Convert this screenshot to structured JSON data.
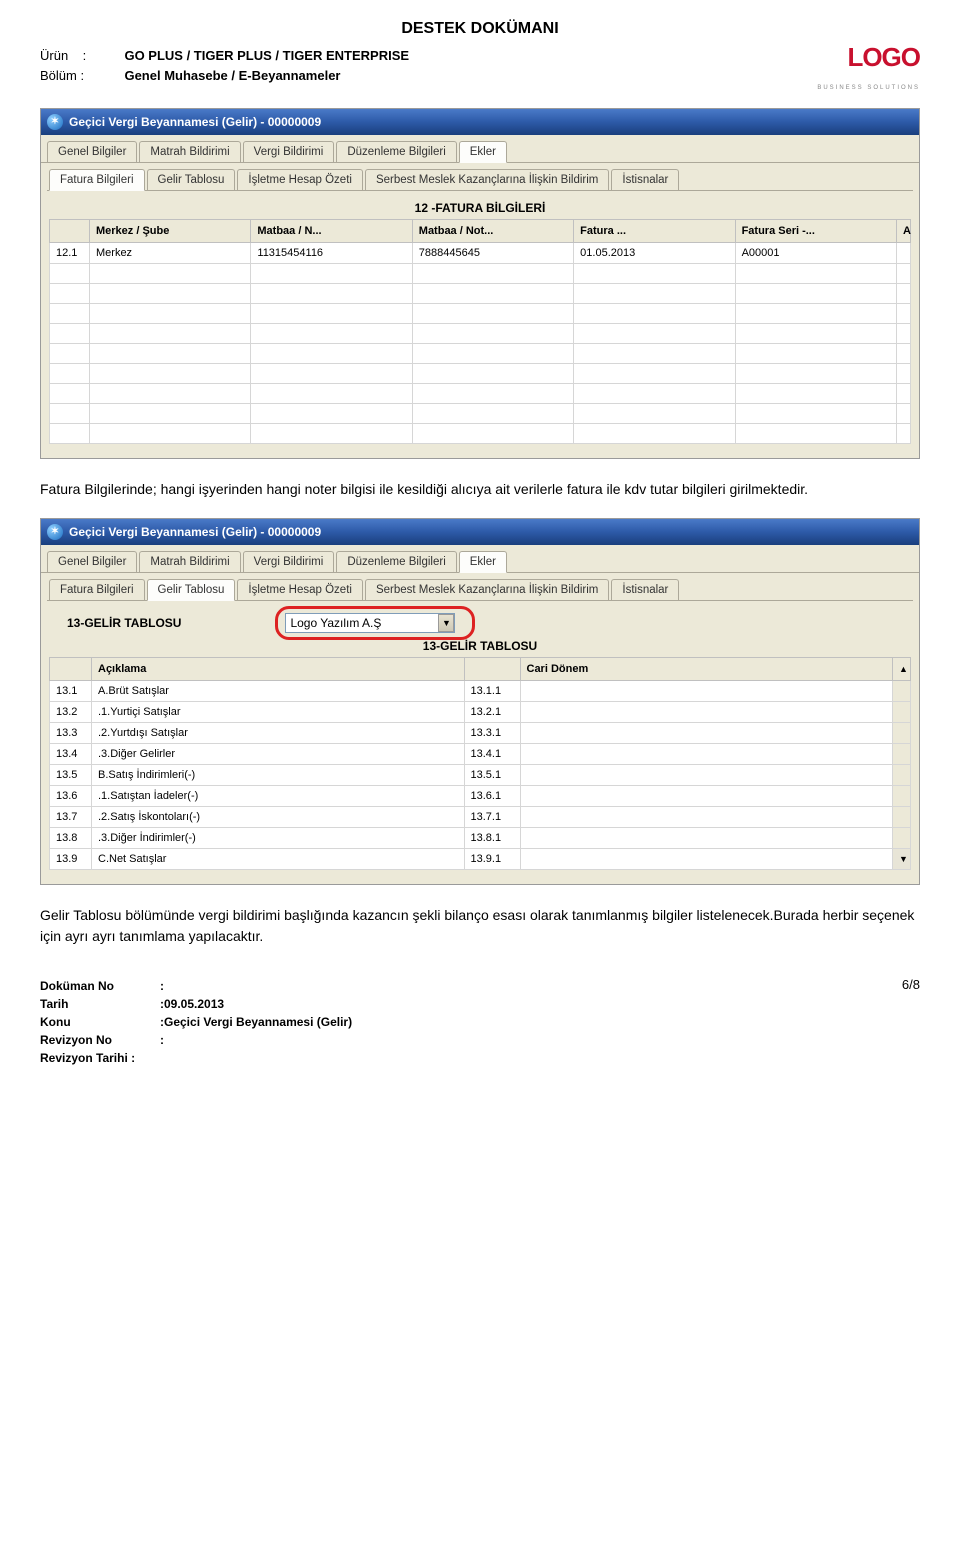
{
  "doc_title": "DESTEK DOKÜMANI",
  "meta": {
    "product_label": "Ürün",
    "product_value": "GO PLUS / TIGER PLUS / TIGER ENTERPRISE",
    "section_label": "Bölüm",
    "section_value": "Genel Muhasebe / E-Beyannameler",
    "colon": ":"
  },
  "logo": {
    "name": "LOGO",
    "sub": "BUSINESS   SOLUTIONS"
  },
  "window1": {
    "title": "Geçici Vergi Beyannamesi (Gelir) - 00000009",
    "main_tabs": [
      "Genel Bilgiler",
      "Matrah Bildirimi",
      "Vergi Bildirimi",
      "Düzenleme Bilgileri",
      "Ekler"
    ],
    "main_active_index": 4,
    "sub_tabs": [
      "Fatura Bilgileri",
      "Gelir Tablosu",
      "İşletme Hesap Özeti",
      "Serbest Meslek Kazançlarına İlişkin Bildirim",
      "İstisnalar"
    ],
    "sub_active_index": 0,
    "section_title": "12 -FATURA BİLGİLERİ",
    "columns": [
      "",
      "Merkez / Şube",
      "Matbaa / N...",
      "Matbaa / Not...",
      "Fatura ...",
      "Fatura Seri -...",
      "A"
    ],
    "rows": [
      [
        "12.1",
        "Merkez",
        "11315454116",
        "7888445645",
        "01.05.2013",
        "A00001",
        ""
      ]
    ],
    "blank_row_count": 9
  },
  "para1": "Fatura Bilgilerinde; hangi işyerinden hangi noter bilgisi ile kesildiği alıcıya ait verilerle fatura ile kdv tutar bilgileri girilmektedir.",
  "window2": {
    "title": "Geçici Vergi Beyannamesi (Gelir) - 00000009",
    "main_tabs": [
      "Genel Bilgiler",
      "Matrah Bildirimi",
      "Vergi Bildirimi",
      "Düzenleme Bilgileri",
      "Ekler"
    ],
    "main_active_index": 4,
    "sub_tabs": [
      "Fatura Bilgileri",
      "Gelir Tablosu",
      "İşletme Hesap Özeti",
      "Serbest Meslek Kazançlarına İlişkin Bildirim",
      "İstisnalar"
    ],
    "sub_active_index": 1,
    "section_label_left": "13-GELİR TABLOSU",
    "dropdown_value": "Logo Yazılım A.Ş",
    "section_title": "13-GELİR TABLOSU",
    "columns": [
      "",
      "Açıklama",
      "",
      "Cari Dönem"
    ],
    "rows": [
      [
        "13.1",
        "A.Brüt Satışlar",
        "13.1.1",
        ""
      ],
      [
        "13.2",
        ".1.Yurtiçi Satışlar",
        "13.2.1",
        ""
      ],
      [
        "13.3",
        ".2.Yurtdışı Satışlar",
        "13.3.1",
        ""
      ],
      [
        "13.4",
        ".3.Diğer Gelirler",
        "13.4.1",
        ""
      ],
      [
        "13.5",
        "B.Satış İndirimleri(-)",
        "13.5.1",
        ""
      ],
      [
        "13.6",
        ".1.Satıştan İadeler(-)",
        "13.6.1",
        ""
      ],
      [
        "13.7",
        ".2.Satış İskontoları(-)",
        "13.7.1",
        ""
      ],
      [
        "13.8",
        ".3.Diğer İndirimler(-)",
        "13.8.1",
        ""
      ],
      [
        "13.9",
        "C.Net Satışlar",
        "13.9.1",
        ""
      ]
    ]
  },
  "para2": "Gelir Tablosu bölümünde  vergi bildirimi başlığında kazancın şekli bilanço esası olarak tanımlanmış bilgiler listelenecek.Burada herbir seçenek için ayrı ayrı tanımlama yapılacaktır.",
  "footer": {
    "docno_label": "Doküman No",
    "docno_value": "",
    "date_label": "Tarih",
    "date_value": "09.05.2013",
    "topic_label": "Konu",
    "topic_value": "Geçici Vergi Beyannamesi (Gelir)",
    "revno_label": "Revizyon No",
    "revno_value": "",
    "revdate_label": "Revizyon Tarihi :",
    "colon": ":",
    "page": "6/8"
  },
  "scroll": {
    "up": "▲",
    "down": "▼"
  }
}
